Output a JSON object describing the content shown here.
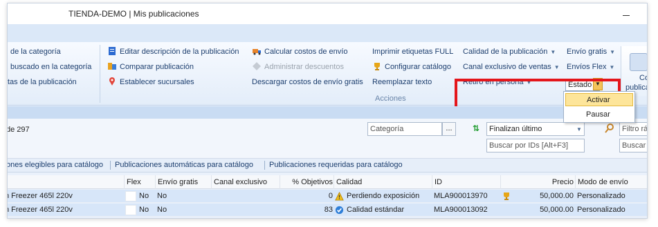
{
  "window": {
    "title": "TIENDA-DEMO | Mis publicaciones"
  },
  "ribbon": {
    "col1": [
      "de la categoría",
      "buscado en la categoría",
      "tas de la publicación"
    ],
    "col2": [
      "Editar descripción de la publicación",
      "Comparar publicación",
      "Establecer sucursales"
    ],
    "col3": [
      "Calcular costos de envío",
      "Administrar descuentos",
      "Descargar costos de envío gratis"
    ],
    "col4": [
      "Imprimir etiquetas FULL",
      "Configurar catálogo",
      "Reemplazar texto"
    ],
    "col5": [
      "Calidad de la publicación",
      "Canal exclusivo de ventas",
      "Retiro en persona"
    ],
    "col6": [
      "Envío gratis",
      "Envíos Flex",
      "Estado"
    ],
    "group_label": "Acciones",
    "big_button": [
      "Co",
      "publica"
    ]
  },
  "estado_menu": {
    "items": [
      "Activar",
      "Pausar"
    ]
  },
  "filters": {
    "count": "de 297",
    "category_placeholder": "Categoría",
    "category_button": "...",
    "sort_value": "Finalizan último",
    "search_ids_placeholder": "Buscar por IDs [Alt+F3]",
    "quick_filter": "Filtro ráp",
    "search2": "Buscar S"
  },
  "tabs": [
    "ones elegibles para catálogo",
    "Publicaciones automáticas para catálogo",
    "Publicaciones requeridas para catálogo"
  ],
  "grid": {
    "columns": [
      "Flex",
      "Envío gratis",
      "Canal exclusivo",
      "% Objetivos",
      "Calidad",
      "ID",
      "Precio",
      "Modo de envío"
    ],
    "rows": [
      {
        "title": "n Freezer 465l 220v",
        "flex": "No",
        "envio_gratis": "No",
        "canal": "",
        "objetivos": "0",
        "calidad": "Perdiendo exposición",
        "id": "MLA900013970",
        "precio": "50,000.00",
        "modo": "Personalizado"
      },
      {
        "title": "n Freezer 465l 220v",
        "flex": "No",
        "envio_gratis": "No",
        "canal": "",
        "objetivos": "83",
        "calidad": "Calidad estándar",
        "id": "MLA900013092",
        "precio": "50,000.00",
        "modo": "Personalizado"
      }
    ]
  },
  "colors": {
    "highlight": "#e4161b",
    "ribbon_text": "#1c3e6e",
    "row_bg": "#d7e6f9",
    "menu_active": "#fde59a"
  }
}
